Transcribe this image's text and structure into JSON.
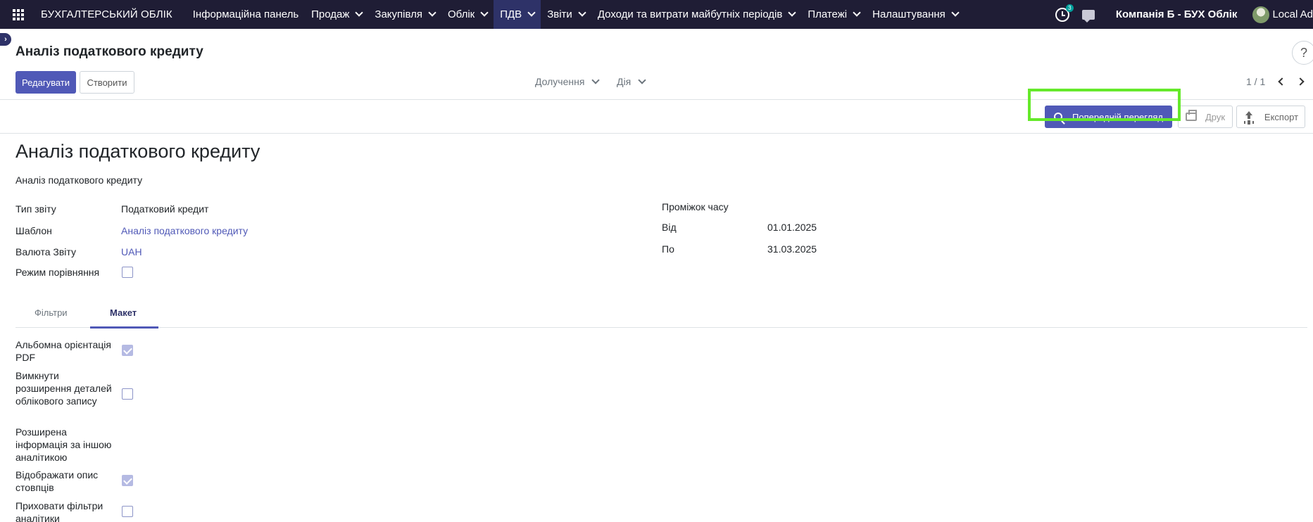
{
  "navbar": {
    "brand": "БУХГАЛТЕРСЬКИЙ ОБЛІК",
    "menu": [
      {
        "label": "Інформаційна панель",
        "dropdown": false
      },
      {
        "label": "Продаж",
        "dropdown": true
      },
      {
        "label": "Закупівля",
        "dropdown": true
      },
      {
        "label": "Облік",
        "dropdown": true
      },
      {
        "label": "ПДВ",
        "dropdown": true,
        "active": true
      },
      {
        "label": "Звіти",
        "dropdown": true
      },
      {
        "label": "Доходи та витрати майбутніх періодів",
        "dropdown": true
      },
      {
        "label": "Платежі",
        "dropdown": true
      },
      {
        "label": "Налаштування",
        "dropdown": true
      }
    ],
    "activity_count": "3",
    "company": "Компанія Б - БУХ Облік",
    "user": "Local Ad"
  },
  "control_panel": {
    "title": "Аналіз податкового кредиту",
    "edit_label": "Редагувати",
    "create_label": "Створити",
    "attachments_label": "Долучення",
    "action_label": "Дія",
    "pager": "1 / 1",
    "help": "?"
  },
  "header_buttons": {
    "preview_label": "Попередній перегляд",
    "print_label": "Друк",
    "export_label": "Експорт"
  },
  "form": {
    "title": "Аналіз податкового кредиту",
    "subtitle": "Аналіз податкового кредиту",
    "report_type_label": "Тип звіту",
    "report_type_value": "Податковий кредит",
    "template_label": "Шаблон",
    "template_value": "Аналіз податкового кредиту",
    "currency_label": "Валюта Звіту",
    "currency_value": "UAH",
    "comparison_label": "Режим порівняння",
    "comparison_checked": false,
    "period_label": "Проміжок часу",
    "from_label": "Від",
    "from_value": "01.01.2025",
    "to_label": "По",
    "to_value": "31.03.2025"
  },
  "tabs": {
    "filters": "Фільтри",
    "layout": "Макет",
    "active": "layout"
  },
  "layout_options": {
    "landscape_label": "Альбомна орієнтація PDF",
    "landscape_checked": true,
    "disable_expand_label": "Вимкнути розширення деталей облікового запису",
    "disable_expand_checked": false,
    "extended_info_label": "Розширена інформація за іншою аналітикою",
    "show_col_desc_label": "Відображати опис стовпців",
    "show_col_desc_checked": true,
    "hide_filters_label": "Приховати фільтри аналітики",
    "hide_filters_checked": false
  },
  "colors": {
    "navbar_bg": "#1f1d35",
    "primary": "#5059b7",
    "highlight": "#65e92a"
  }
}
